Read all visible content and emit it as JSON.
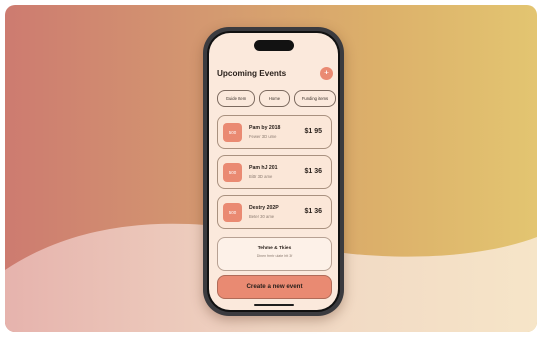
{
  "header": {
    "title": "Upcoming Events",
    "action_icon": "plus-icon"
  },
  "chips": [
    {
      "label": "Guide Item"
    },
    {
      "label": "Home"
    },
    {
      "label": "Funding items"
    }
  ],
  "events": [
    {
      "badge": "500",
      "name": "Pam by 2018",
      "sub": "Fewer 3D ume",
      "price": "$1 95"
    },
    {
      "badge": "500",
      "name": "Pam hJ 201",
      "sub": "Bittr 3D ame",
      "price": "$1 36"
    },
    {
      "badge": "500",
      "name": "Destry 202P",
      "sub": "Beter 30 ame",
      "price": "$1 36"
    }
  ],
  "info": {
    "title": "Tehme & Tkies",
    "sub": "Dinen frmtr ulate htt 3f"
  },
  "cta": {
    "label": "Create a new event"
  },
  "colors": {
    "accent": "#ea8a72",
    "screen_bg": "#fbe9dc",
    "text": "#2a211c"
  }
}
